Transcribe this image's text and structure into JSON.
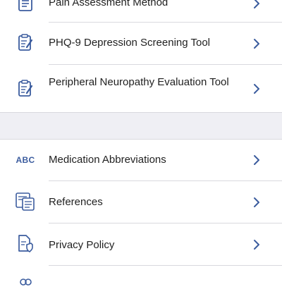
{
  "colors": {
    "accent": "#3b5c9e",
    "text": "#1f1f1f",
    "divider": "#d9d9de",
    "section_gap": "#efeff4"
  },
  "section1": {
    "items": [
      {
        "label": "Pain Assessment Method",
        "icon": "clipboard-list-icon"
      },
      {
        "label": "PHQ-9 Depression Screening Tool",
        "icon": "clipboard-edit-icon"
      },
      {
        "label": "Peripheral Neuropathy Evaluation Tool",
        "icon": "clipboard-edit-icon"
      }
    ]
  },
  "section2": {
    "items": [
      {
        "label": "Medication Abbreviations",
        "icon_text": "ABC",
        "icon": "abc-icon"
      },
      {
        "label": "References",
        "icon": "documents-icon"
      },
      {
        "label": "Privacy Policy",
        "icon": "privacy-document-icon"
      },
      {
        "label": "",
        "icon": "people-icon"
      }
    ]
  }
}
